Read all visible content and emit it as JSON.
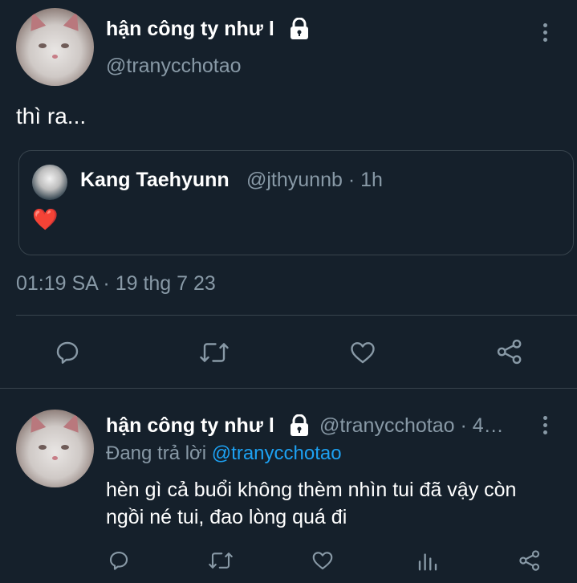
{
  "main_tweet": {
    "author": {
      "display_name": "hận công ty như l",
      "handle": "@tranycchotao",
      "protected_icon": "lock-icon"
    },
    "text": "thì ra...",
    "quoted_tweet": {
      "author_name": "Kang Taehyunn",
      "meta": "@jthyunnb · 1h",
      "text": "❤️"
    },
    "timestamp": "01:19 SA · 19 thg 7 23",
    "actions": [
      "reply-icon",
      "retweet-icon",
      "like-icon",
      "share-icon"
    ]
  },
  "reply_tweet": {
    "author": {
      "display_name": "hận công ty như l",
      "handle_meta": "@tranycchotao · 4…",
      "protected_icon": "lock-icon"
    },
    "replying_to_label": "Đang trả lời",
    "replying_to_handle": "@tranycchotao",
    "text": "hèn gì cả buổi không thèm nhìn tui đã vậy còn ngồi né tui, đao lòng quá đi",
    "actions": [
      "reply-icon",
      "retweet-icon",
      "like-icon",
      "analytics-icon",
      "share-icon"
    ]
  },
  "colors": {
    "background": "#15202b",
    "secondary_text": "#8899a6",
    "link": "#1da1f2",
    "divider": "#38444d",
    "heart": "#e0245e"
  }
}
